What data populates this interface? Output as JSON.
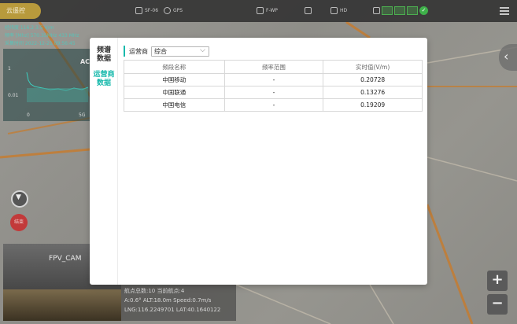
{
  "topbar": {
    "mode": "云遥控",
    "items": [
      {
        "icon": "remote-signal-icon",
        "label": "SF-06"
      },
      {
        "icon": "gps-icon",
        "label": "GPS"
      },
      {
        "icon": "drone-mode-icon",
        "label": "F-WP"
      },
      {
        "icon": "rc-signal-icon",
        "label": ""
      },
      {
        "icon": "hd-signal-icon",
        "label": "HD"
      }
    ]
  },
  "map_overlay": {
    "info_lines": [
      "经纬度 116.2 3.5 V/m",
      "频率 [Mhz] 570.35MHz  433 MHz",
      "采集时间 2022-12-21 09:56:45"
    ],
    "spectrum": {
      "tag": "AC",
      "y_ticks": [
        "1",
        "0.01"
      ],
      "x_ticks": [
        "0",
        "5G"
      ]
    },
    "end_button": "结束",
    "fpv_label": "FPV_CAM",
    "flight_info": [
      "航点总数:10 当前航点:4",
      "A:0.6° ALT:18.0m Speed:0.7m/s",
      "LNG:116.2249701 LAT:40.1640122"
    ],
    "zoom_in": "+",
    "zoom_out": "−"
  },
  "modal": {
    "tabs": [
      {
        "label": "频谱数据",
        "active": false
      },
      {
        "label": "运营商数据",
        "active": true
      }
    ],
    "filter": {
      "label": "运营商",
      "value": "综合"
    },
    "table": {
      "headers": [
        "频段名称",
        "频率范围",
        "实时值(V/m)"
      ],
      "rows": [
        [
          "中国移动",
          "-",
          "0.20728"
        ],
        [
          "中国联通",
          "-",
          "0.13276"
        ],
        [
          "中国电信",
          "-",
          "0.19209"
        ]
      ]
    }
  },
  "colors": {
    "accent": "#18b9ac",
    "mode_pill": "#b89a3c",
    "end_button": "#c23a3a"
  }
}
